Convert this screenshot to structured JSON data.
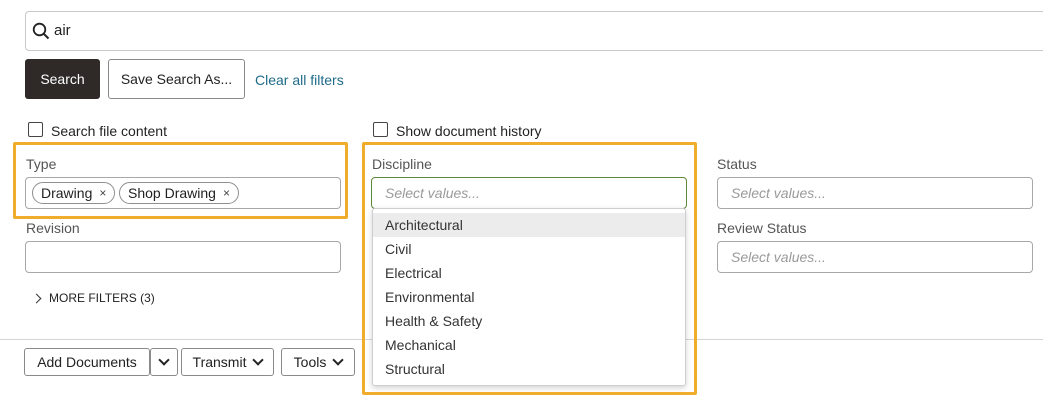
{
  "search": {
    "query": "air"
  },
  "actions": {
    "search_label": "Search",
    "save_search_label": "Save Search As...",
    "clear_filters_label": "Clear all filters"
  },
  "options": {
    "search_file_content": "Search file content",
    "show_document_history": "Show document history"
  },
  "filters": {
    "type": {
      "label": "Type",
      "chips": [
        "Drawing",
        "Shop Drawing"
      ]
    },
    "discipline": {
      "label": "Discipline",
      "placeholder": "Select values..."
    },
    "status": {
      "label": "Status",
      "placeholder": "Select values..."
    },
    "revision": {
      "label": "Revision"
    },
    "review_status": {
      "label": "Review Status",
      "placeholder": "Select values..."
    },
    "more_filters": "MORE FILTERS (3)"
  },
  "discipline_dropdown": {
    "options": [
      "Architectural",
      "Civil",
      "Electrical",
      "Environmental",
      "Health & Safety",
      "Mechanical",
      "Structural"
    ]
  },
  "toolbar": {
    "add_documents": "Add Documents",
    "transmit": "Transmit",
    "tools": "Tools"
  },
  "colors": {
    "primary_button": "#2f2a28",
    "link": "#1f6b8a",
    "highlight": "#f0ad2c",
    "active_field_border": "#5a8a3a"
  }
}
